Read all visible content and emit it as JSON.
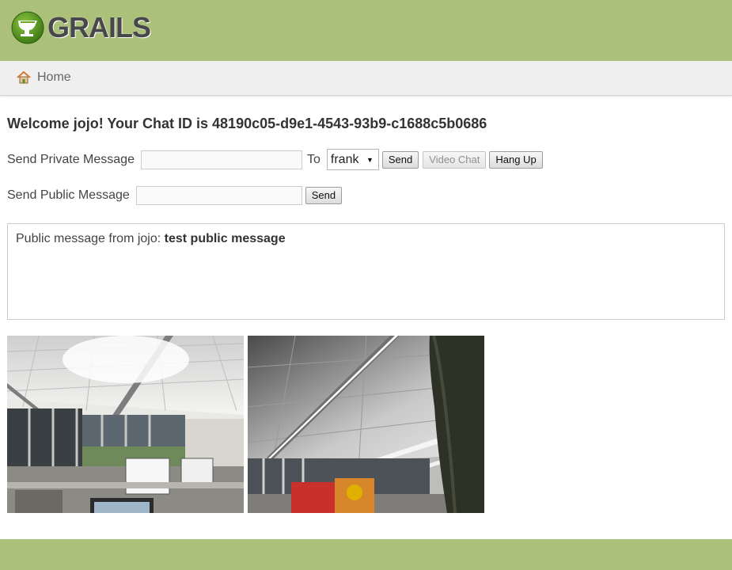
{
  "header": {
    "logo_text": "GRAILS",
    "brand_color": "#abc079",
    "logo_icon": "grails-cup-icon"
  },
  "nav": {
    "home_label": "Home",
    "home_icon": "house-icon"
  },
  "welcome": {
    "text": "Welcome jojo! Your Chat ID is 48190c05-d9e1-4543-93b9-c1688c5b0686"
  },
  "private_message": {
    "label": "Send Private Message",
    "value": "",
    "to_label": "To",
    "recipient": "frank",
    "send_label": "Send",
    "video_chat_label": "Video Chat",
    "hang_up_label": "Hang Up"
  },
  "public_message": {
    "label": "Send Public Message",
    "value": "",
    "send_label": "Send"
  },
  "messages": [
    {
      "prefix": "Public message from jojo:",
      "body": "test public message"
    }
  ],
  "videos": {
    "local_description": "local-webcam-stream",
    "remote_description": "remote-webcam-stream"
  }
}
